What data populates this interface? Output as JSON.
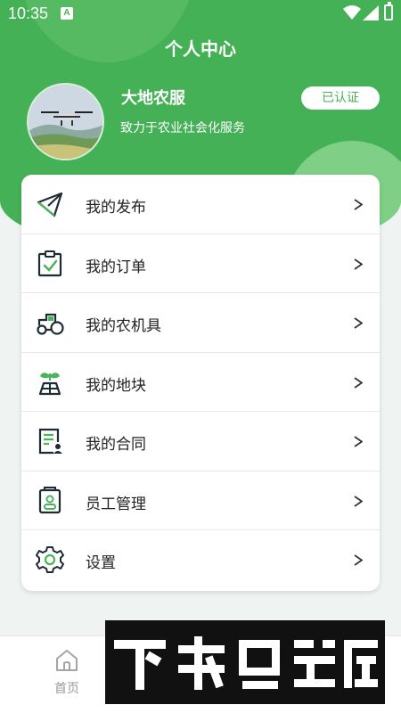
{
  "status_bar": {
    "time": "10:35",
    "notification_letter": "A"
  },
  "header": {
    "title": "个人中心"
  },
  "profile": {
    "name": "大地农服",
    "slogan": "致力于农业社会化服务",
    "verified_label": "已认证"
  },
  "menu": {
    "items": [
      {
        "label": "我的发布",
        "icon": "send-icon"
      },
      {
        "label": "我的订单",
        "icon": "order-clipboard-icon"
      },
      {
        "label": "我的农机具",
        "icon": "tractor-icon"
      },
      {
        "label": "我的地块",
        "icon": "field-sprout-icon"
      },
      {
        "label": "我的合同",
        "icon": "contract-icon"
      },
      {
        "label": "员工管理",
        "icon": "employee-badge-icon"
      },
      {
        "label": "设置",
        "icon": "gear-icon"
      }
    ]
  },
  "tab_bar": {
    "home_label": "首页"
  },
  "colors": {
    "brand_green": "#45b156",
    "accent_green": "#4bb35b",
    "icon_dark": "#1d2b33"
  }
}
